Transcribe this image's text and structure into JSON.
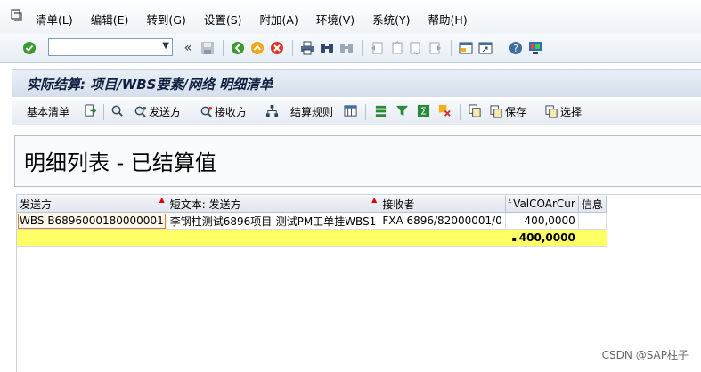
{
  "menu": [
    "清单(L)",
    "编辑(E)",
    "转到(G)",
    "设置(S)",
    "附加(A)",
    "环境(V)",
    "系统(Y)",
    "帮助(H)"
  ],
  "command_field": {
    "value": "",
    "placeholder": ""
  },
  "title": "实际结算: 项目/WBS要素/网络 明细清单",
  "app_toolbar": {
    "basic_list": "基本清单",
    "sender": "发送方",
    "receiver": "接收方",
    "settlement_rule": "结算规则",
    "save": "保存",
    "select": "选择"
  },
  "section_heading": "明细列表 - 已结算值",
  "table": {
    "headers": [
      "发送方",
      "短文本: 发送方",
      "接收者",
      "ValCOArCur",
      "信息"
    ],
    "rows": [
      {
        "sender": "WBS B6896000180000001",
        "text": "李钢柱测试6896项目-测试PM工单挂WBS1",
        "receiver": "FXA 6896/82000001/0",
        "value": "400,0000",
        "info": ""
      }
    ],
    "total": "400,0000"
  },
  "watermark": "CSDN @SAP柱子",
  "colors": {
    "total_row": "#ffff66",
    "title_bar": "#d4dfeb",
    "selection": "#e07a20"
  }
}
